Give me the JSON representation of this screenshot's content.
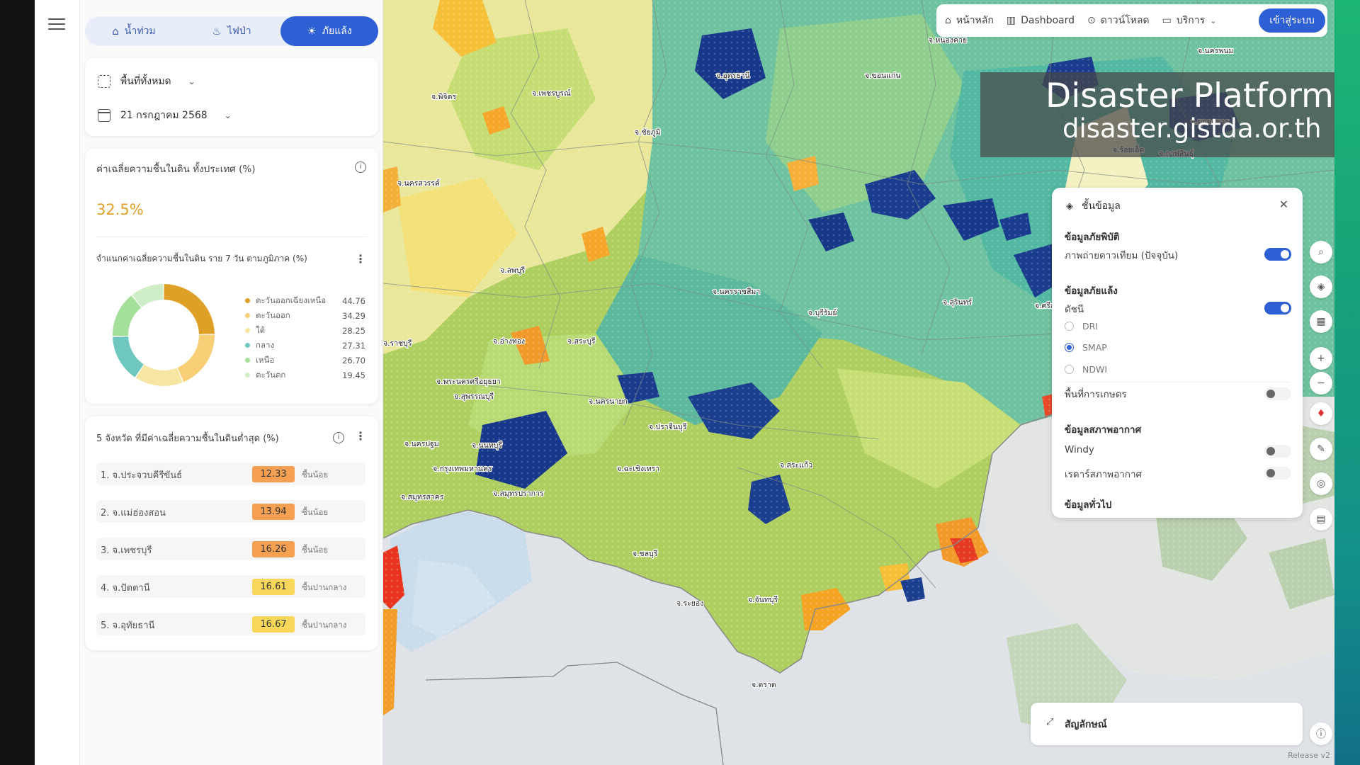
{
  "tabs": [
    {
      "label": "น้ำท่วม",
      "icon": "flood-icon"
    },
    {
      "label": "ไฟป่า",
      "icon": "fire-icon"
    },
    {
      "label": "ภัยแล้ง",
      "icon": "drought-icon"
    }
  ],
  "filter": {
    "area": "พื้นที่ทั้งหมด",
    "date": "21 กรกฎาคม 2568"
  },
  "avg_card": {
    "title": "ค่าเฉลี่ยความชื้นในดิน ทั้งประเทศ (%)",
    "value": "32.5%",
    "distribution_title": "จำแนกค่าเฉลี่ยความชื้นในดิน ราย 7 วัน ตามภูมิภาค (%)"
  },
  "chart_data": {
    "type": "pie",
    "categories": [
      "ตะวันออกเฉียงเหนือ",
      "ตะวันออก",
      "ใต้",
      "กลาง",
      "เหนือ",
      "ตะวันตก"
    ],
    "values": [
      44.76,
      34.29,
      28.25,
      27.31,
      26.7,
      19.45
    ],
    "value_labels": [
      "44.76",
      "34.29",
      "28.25",
      "27.31",
      "26.70",
      "19.45"
    ],
    "colors": [
      "#dea026",
      "#f8cf76",
      "#f6e6a2",
      "#6ec8c0",
      "#a5e09a",
      "#cdeec6"
    ],
    "donut": true
  },
  "low_card": {
    "title": "5 จังหวัด ที่มีค่าเฉลี่ยความชื้นในดินต่ำสุด (%)",
    "rows": [
      {
        "name": "1. จ.ประจวบคีรีขันธ์",
        "value": "12.33",
        "level": "ชื้นน้อย",
        "color": "#f5a053"
      },
      {
        "name": "2. จ.แม่ฮ่องสอน",
        "value": "13.94",
        "level": "ชื้นน้อย",
        "color": "#f5a053"
      },
      {
        "name": "3. จ.เพชรบุรี",
        "value": "16.26",
        "level": "ชื้นน้อย",
        "color": "#f5a053"
      },
      {
        "name": "4. จ.ปัตตานี",
        "value": "16.61",
        "level": "ชื้นปานกลาง",
        "color": "#f8d75a"
      },
      {
        "name": "5. จ.อุทัยธานี",
        "value": "16.67",
        "level": "ชื้นปานกลาง",
        "color": "#f8d75a"
      }
    ]
  },
  "nav": {
    "home": "หน้าหลัก",
    "dashboard": "Dashboard",
    "download": "ดาวน์โหลด",
    "services": "บริการ",
    "login": "เข้าสู่ระบบ"
  },
  "watermark": {
    "line1": "Disaster Platform",
    "line2": "disaster.gistda.or.th"
  },
  "layers": {
    "title": "ชั้นข้อมูล",
    "disaster_section": "ข้อมูลภัยพิบัติ",
    "satellite": "ภาพถ่ายดาวเทียม (ปัจจุบัน)",
    "drought_section": "ข้อมูลภัยแล้ง",
    "index": "ดัชนี",
    "options": [
      "DRI",
      "SMAP",
      "NDWI"
    ],
    "selected": "SMAP",
    "agri": "พื้นที่การเกษตร",
    "weather_section": "ข้อมูลสภาพอากาศ",
    "windy": "Windy",
    "radar": "เรดาร์สภาพอากาศ",
    "general_section": "ข้อมูลทั่วไป"
  },
  "map_labels": [
    "จ.หนองคาย",
    "จ.อุดรธานี",
    "จ.สกลนคร",
    "จ.นครพนม",
    "จ.มุกดาหาร",
    "จ.ร้อยเอ็ด",
    "จ.กาฬสินธุ์",
    "จ.พิจิตร",
    "จ.เพชรบูรณ์",
    "จ.ชัยภูมิ",
    "จ.ขอนแก่น",
    "จ.นครสวรรค์",
    "จ.ลพบุรี",
    "จ.นครราชสีมา",
    "จ.บุรีรัมย์",
    "จ.สุรินทร์",
    "จ.ศรีสะเกษ",
    "จ.อุบลราชธานี",
    "จ.สระบุรี",
    "จ.อ่างทอง",
    "จ.สุพรรณบุรี",
    "จ.พระนครศรีอยุธยา",
    "จ.นครนายก",
    "จ.ปราจีนบุรี",
    "จ.นครปฐม",
    "จ.กรุงเทพมหานคร",
    "จ.สมุทรปราการ",
    "จ.ฉะเชิงเทรา",
    "จ.สระแก้ว",
    "จ.ชลบุรี",
    "จ.ระยอง",
    "จ.จันทบุรี",
    "จ.ตราด",
    "จ.สมุทรสาคร",
    "จ.ราชบุรี",
    "จ.นนทบุรี"
  ],
  "legend_bar": "สัญลักษณ์",
  "release": "Release v2"
}
